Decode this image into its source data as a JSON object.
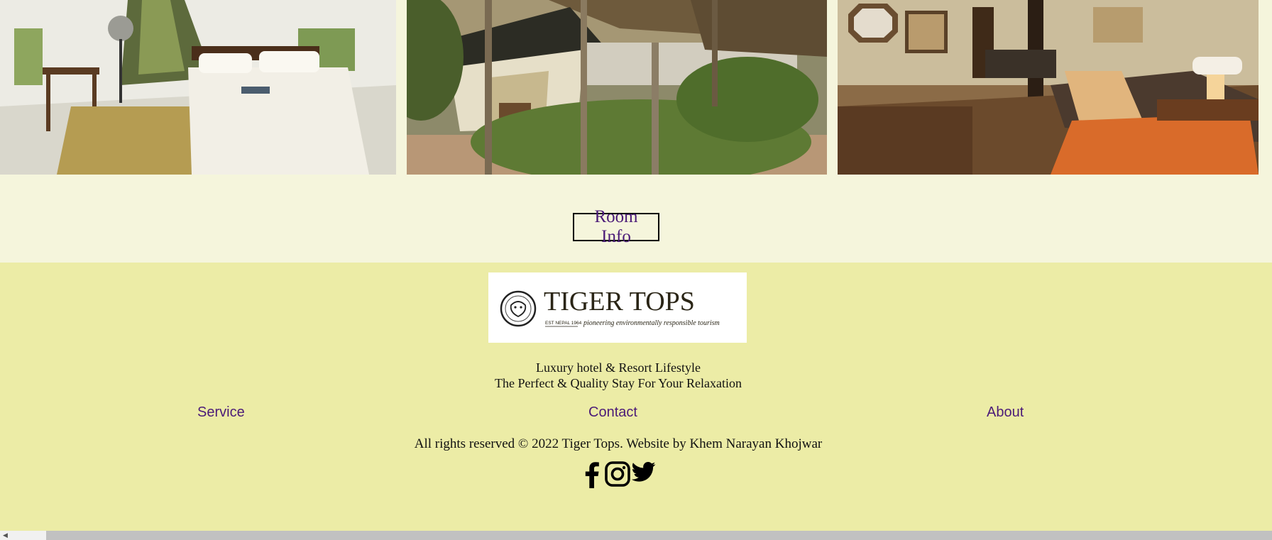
{
  "gallery": {
    "images": [
      {
        "icon": "tent-bedroom-photo"
      },
      {
        "icon": "jungle-tent-exterior-photo"
      },
      {
        "icon": "lodge-room-photo"
      }
    ]
  },
  "room_button": {
    "label": "Room Info"
  },
  "footer": {
    "logo": {
      "brand": "TIGER TOPS",
      "est": "EST NEPAL 1964",
      "motto": "pioneering environmentally responsible tourism"
    },
    "tagline_1": "Luxury hotel & Resort Lifestyle",
    "tagline_2": "The Perfect & Quality Stay For Your Relaxation",
    "nav": {
      "service": "Service",
      "contact": "Contact",
      "about": "About"
    },
    "copyright": "All rights reserved © 2022 Tiger Tops. Website by Khem Narayan Khojwar",
    "social": [
      "facebook-icon",
      "instagram-icon",
      "twitter-icon"
    ]
  },
  "colors": {
    "page_bg": "#f5f5dc",
    "footer_bg": "#ececa6",
    "link": "#4b1b78"
  }
}
